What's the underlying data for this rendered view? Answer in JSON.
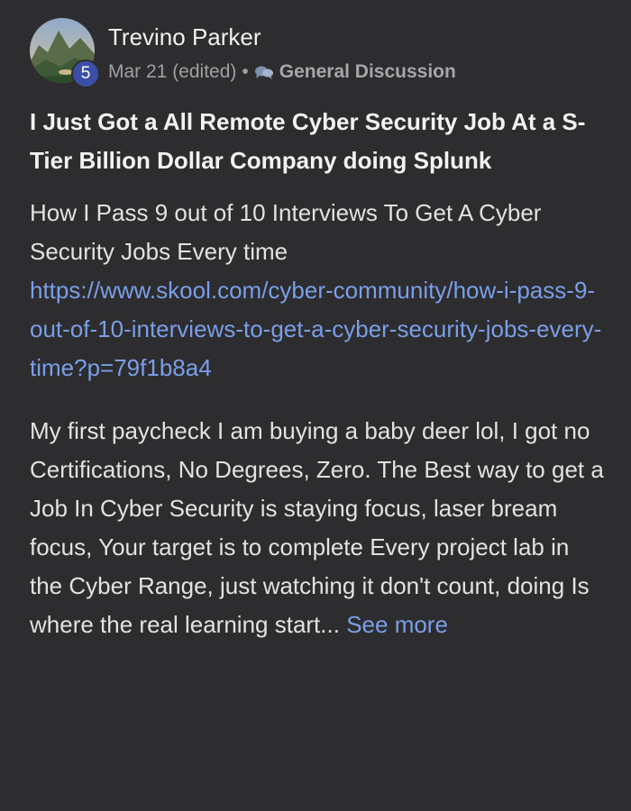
{
  "author": {
    "name": "Trevino Parker",
    "level": "5"
  },
  "meta": {
    "date": "Mar 21 (edited)",
    "separator": "•",
    "category_icon": "speech-bubbles-icon",
    "category": "General Discussion"
  },
  "post": {
    "title": "I Just Got a All Remote Cyber Security Job At a S-Tier Billion Dollar Company doing Splunk",
    "intro": "How I Pass 9 out of 10 Interviews To Get A Cyber Security Jobs Every time",
    "link": "https://www.skool.com/cyber-community/how-i-pass-9-out-of-10-interviews-to-get-a-cyber-security-jobs-every-time?p=79f1b8a4",
    "body": "My first paycheck I am buying a baby deer lol, I got no Certifications, No Degrees, Zero. The Best way to get a Job In Cyber Security is staying focus, laser bream focus, Your target is to complete Every project lab in the Cyber Range, just watching it don't count, doing Is where the real learning start...",
    "see_more": "See more"
  },
  "colors": {
    "background": "#2d2d2f",
    "link": "#7b9ee8",
    "badge": "#3b4fa8"
  }
}
